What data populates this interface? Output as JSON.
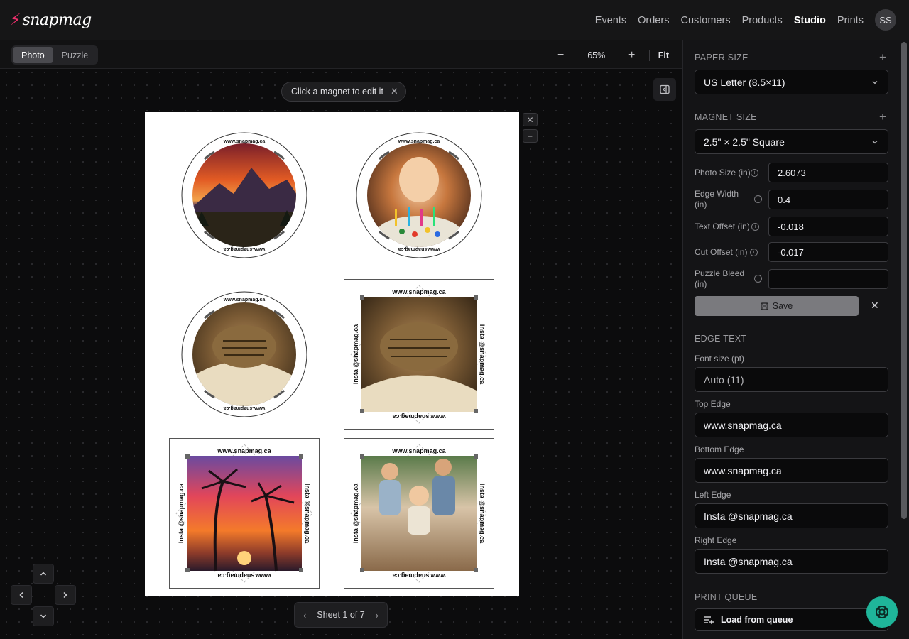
{
  "app": {
    "logo_text": "snapmag",
    "nav": [
      "Events",
      "Orders",
      "Customers",
      "Products",
      "Studio",
      "Prints"
    ],
    "active_nav": "Studio",
    "avatar_initials": "SS"
  },
  "toolbar": {
    "modes": [
      "Photo",
      "Puzzle"
    ],
    "active_mode": "Photo",
    "zoom_out": "−",
    "zoom_value": "65%",
    "zoom_in": "+",
    "fit_label": "Fit"
  },
  "hint": {
    "text": "Click a magnet to edit it",
    "close": "✕"
  },
  "sheet": {
    "remove": "✕",
    "add": "+",
    "pager_label": "Sheet 1 of 7",
    "magnets": [
      {
        "shape": "circle",
        "photo": "mountain sunset",
        "top_text": "www.snapmag.ca",
        "bottom_text": "www.snapmag.ca"
      },
      {
        "shape": "circle",
        "photo": "child with birthday cake",
        "top_text": "www.snapmag.ca",
        "bottom_text": "www.snapmag.ca"
      },
      {
        "shape": "circle",
        "photo": "sleeping cat",
        "top_text": "www.snapmag.ca",
        "bottom_text": "www.snapmag.ca"
      },
      {
        "shape": "square",
        "photo": "sleeping cat",
        "top_text": "www.snapmag.ca",
        "bottom_text": "www.snapmag.ca",
        "left_text": "Insta @snapmag.ca",
        "right_text": "Insta @snapmag.ca"
      },
      {
        "shape": "square",
        "photo": "palm trees sunset",
        "top_text": "www.snapmag.ca",
        "bottom_text": "www.snapmag.ca",
        "left_text": "Insta @snapmag.ca",
        "right_text": "Insta @snapmag.ca"
      },
      {
        "shape": "square",
        "photo": "family with baby",
        "top_text": "www.snapmag.ca",
        "bottom_text": "www.snapmag.ca",
        "left_text": "Insta @snapmag.ca",
        "right_text": "Insta @snapmag.ca"
      }
    ]
  },
  "panel": {
    "paper_size_title": "PAPER SIZE",
    "paper_size_value": "US Letter (8.5×11)",
    "magnet_size_title": "MAGNET SIZE",
    "magnet_size_value": "2.5\" × 2.5\" Square",
    "params": [
      {
        "label": "Photo Size (in)",
        "value": "2.6073"
      },
      {
        "label": "Edge Width (in)",
        "value": "0.4"
      },
      {
        "label": "Text Offset (in)",
        "value": "-0.018"
      },
      {
        "label": "Cut Offset (in)",
        "value": "-0.017"
      },
      {
        "label": "Puzzle Bleed (in)",
        "value": ""
      }
    ],
    "save_label": "Save",
    "edge_text_title": "EDGE TEXT",
    "font_size_label": "Font size (pt)",
    "font_size_value": "Auto (11)",
    "top_edge_label": "Top Edge",
    "top_edge_value": "www.snapmag.ca",
    "bottom_edge_label": "Bottom Edge",
    "bottom_edge_value": "www.snapmag.ca",
    "left_edge_label": "Left Edge",
    "left_edge_value": "Insta @snapmag.ca",
    "right_edge_label": "Right Edge",
    "right_edge_value": "Insta @snapmag.ca",
    "print_queue_title": "PRINT QUEUE",
    "load_queue_label": "Load from queue"
  },
  "colors": {
    "accent": "#ef2f6c",
    "help_fab": "#1fb59a"
  }
}
